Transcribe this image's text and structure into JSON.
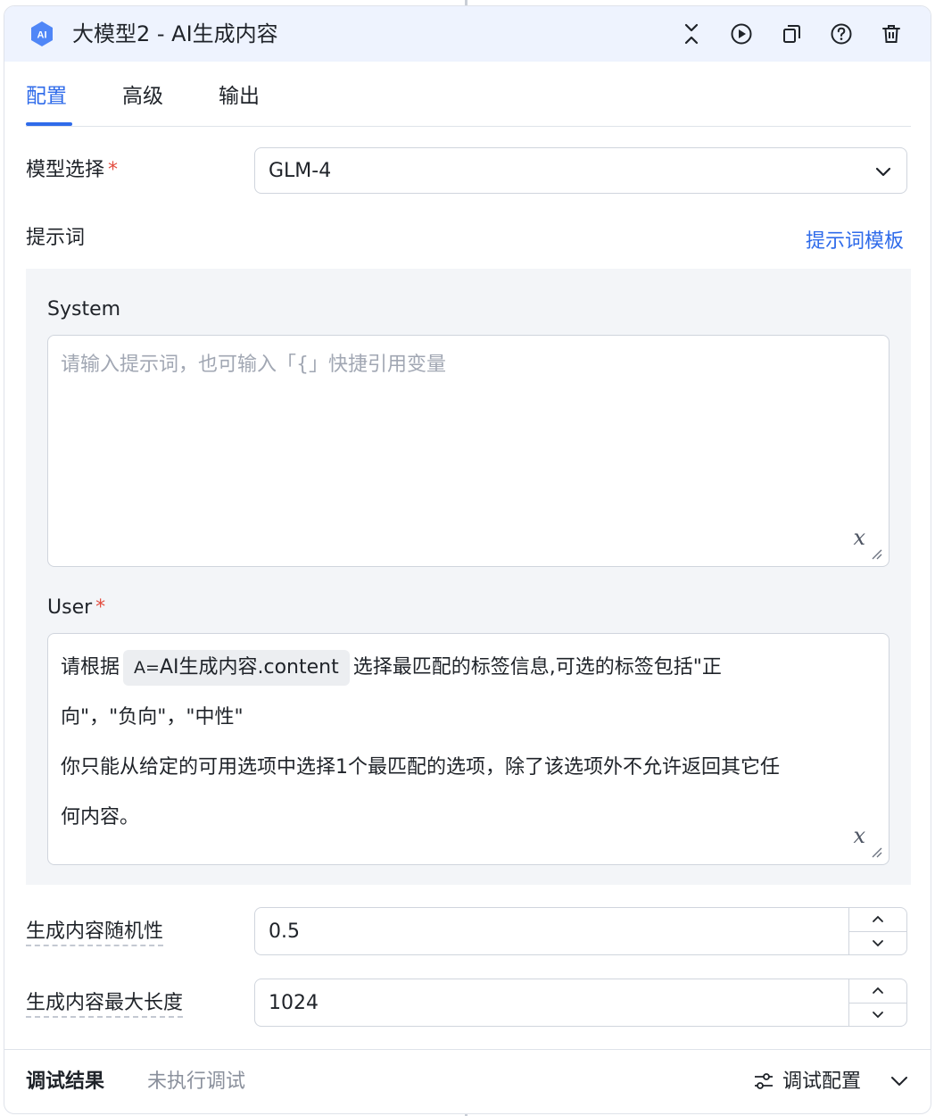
{
  "header": {
    "badge": "AI",
    "title": "大模型2 - AI生成内容",
    "actions": [
      "collapse-icon",
      "run-icon",
      "copy-icon",
      "help-icon",
      "delete-icon"
    ]
  },
  "tabs": [
    {
      "label": "配置",
      "active": true
    },
    {
      "label": "高级",
      "active": false
    },
    {
      "label": "输出",
      "active": false
    }
  ],
  "model": {
    "label": "模型选择",
    "required_mark": "*",
    "value": "GLM-4"
  },
  "prompt": {
    "label": "提示词",
    "template_link": "提示词模板",
    "system": {
      "label": "System",
      "placeholder": "请输入提示词，也可输入「{」快捷引用变量"
    },
    "user": {
      "label": "User",
      "required_mark": "*",
      "text_before": "请根据",
      "chip_prefix": "A=",
      "chip": "AI生成内容.content",
      "text_after_line1": "选择最匹配的标签信息,可选的标签包括\"正",
      "line2": "向\"，\"负向\"，\"中性\"",
      "line3": "你只能从给定的可用选项中选择1个最匹配的选项，除了该选项外不允许返回其它任",
      "line4": "何内容。"
    },
    "var_icon": "𝑥"
  },
  "randomness": {
    "label": "生成内容随机性",
    "value": "0.5"
  },
  "max_length": {
    "label": "生成内容最大长度",
    "value": "1024"
  },
  "footer": {
    "title": "调试结果",
    "status": "未执行调试",
    "debug_config": "调试配置"
  },
  "colors": {
    "accent": "#2f6bea",
    "header_bg": "#eef3fe",
    "required": "#e34d3f",
    "panel_bg": "#f3f5f8"
  }
}
